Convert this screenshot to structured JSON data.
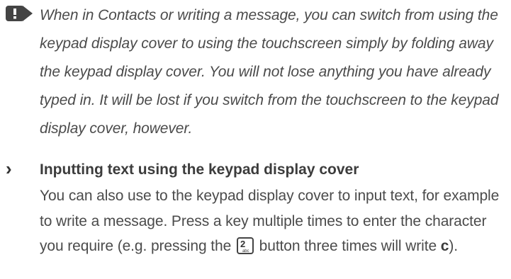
{
  "note": {
    "icon": "exclamation-note-icon",
    "text": "When in Contacts or writing a message, you can switch from using the keypad display cover to using the touchscreen simply by folding away the keypad display cover. You will not lose anything you have already typed in. It will be lost if you switch from the touchscreen to the keypad display cover, however."
  },
  "section": {
    "bullet": "›",
    "title": "Inputting text using the keypad display cover",
    "body_part1": "You can also use to the keypad display cover to input text, for example to write a message. Press a key multiple times to enter the character you require (e.g. pressing the",
    "key_digit": "2",
    "key_letters": "abc",
    "body_part2": "button three times will write",
    "body_char": "c",
    "body_end": ")."
  }
}
